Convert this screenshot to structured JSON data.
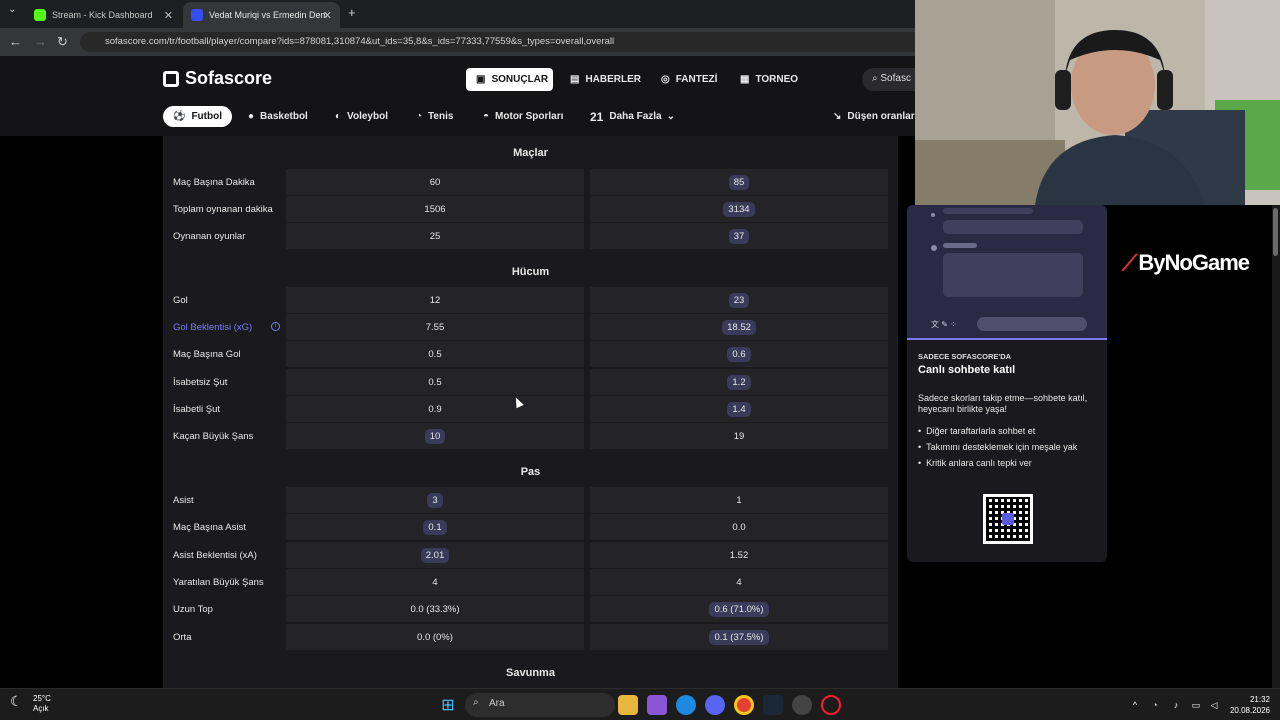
{
  "browser": {
    "tabs": [
      {
        "title": "Stream - Kick Dashboard",
        "icon": "kick-icon",
        "color": "#53fc18"
      },
      {
        "title": "Vedat Muriqi vs Ermedin Demir",
        "icon": "sofascore-icon",
        "color": "#374df5"
      }
    ],
    "url": "sofascore.com/tr/football/player/compare?ids=878081,310874&ut_ids=35,8&s_ids=77333,77559&s_types=overall,overall"
  },
  "site": {
    "logo": "Sofascore",
    "nav": [
      {
        "label": "SONUÇLAR",
        "icon": "results-icon",
        "active": true
      },
      {
        "label": "HABERLER",
        "icon": "news-icon"
      },
      {
        "label": "FANTEZİ",
        "icon": "fantasy-icon"
      },
      {
        "label": "TORNEO",
        "icon": "torneo-icon"
      }
    ],
    "search": "Sofasc",
    "sports": [
      {
        "label": "Futbol",
        "active": true
      },
      {
        "label": "Basketbol"
      },
      {
        "label": "Voleybol"
      },
      {
        "label": "Tenis"
      },
      {
        "label": "Motor Sporları"
      },
      {
        "label": "Daha Fazla",
        "count": "21"
      }
    ],
    "dropping_odds": "Düşen oranlar"
  },
  "compare": {
    "sections": [
      {
        "title": "Maçlar"
      },
      {
        "title": "Hücum"
      },
      {
        "title": "Pas"
      },
      {
        "title": "Savunma"
      }
    ],
    "rows": [
      {
        "label": "Maç Başına Dakika",
        "a": "60",
        "b": "85",
        "best": "b"
      },
      {
        "label": "Toplam oynanan dakika",
        "a": "1506",
        "b": "3134",
        "best": "b"
      },
      {
        "label": "Oynanan oyunlar",
        "a": "25",
        "b": "37",
        "best": "b"
      },
      {
        "label": "Gol",
        "a": "12",
        "b": "23",
        "best": "b"
      },
      {
        "label": "Gol Beklentisi (xG)",
        "a": "7.55",
        "b": "18.52",
        "best": "b",
        "link": true
      },
      {
        "label": "Maç Başına Gol",
        "a": "0.5",
        "b": "0.6",
        "best": "b"
      },
      {
        "label": "İsabetsiz Şut",
        "a": "0.5",
        "b": "1.2",
        "best": "b"
      },
      {
        "label": "İsabetli Şut",
        "a": "0.9",
        "b": "1.4",
        "best": "b"
      },
      {
        "label": "Kaçan Büyük Şans",
        "a": "10",
        "b": "19",
        "best": "a"
      },
      {
        "label": "Asist",
        "a": "3",
        "b": "1",
        "best": "a"
      },
      {
        "label": "Maç Başına Asist",
        "a": "0.1",
        "b": "0.0",
        "best": "a"
      },
      {
        "label": "Asist Beklentisi (xA)",
        "a": "2.01",
        "b": "1.52",
        "best": "a"
      },
      {
        "label": "Yaratılan Büyük Şans",
        "a": "4",
        "b": "4",
        "best": "none"
      },
      {
        "label": "Uzun Top",
        "a": "0.0 (33.3%)",
        "b": "0.6 (71.0%)",
        "best": "b"
      },
      {
        "label": "Orta",
        "a": "0.0 (0%)",
        "b": "0.1 (37.5%)",
        "best": "b"
      }
    ]
  },
  "chat_promo": {
    "kicker": "SADECE SOFASCORE'DA",
    "headline": "Canlı sohbete katıl",
    "description": "Sadece skorları takip etme—sohbete katıl, heyecanı birlikte yaşa!",
    "bullets": [
      "Diğer taraftarlarla sohbet et",
      "Takımını desteklemek için meşale yak",
      "Kritik anlara canlı tepki ver"
    ]
  },
  "sponsor": {
    "text": "ByNoGame"
  },
  "taskbar": {
    "weather_temp": "25°C",
    "weather_desc": "Açık",
    "search": "Ara",
    "time": "21:32",
    "date": "20.08.2026"
  }
}
